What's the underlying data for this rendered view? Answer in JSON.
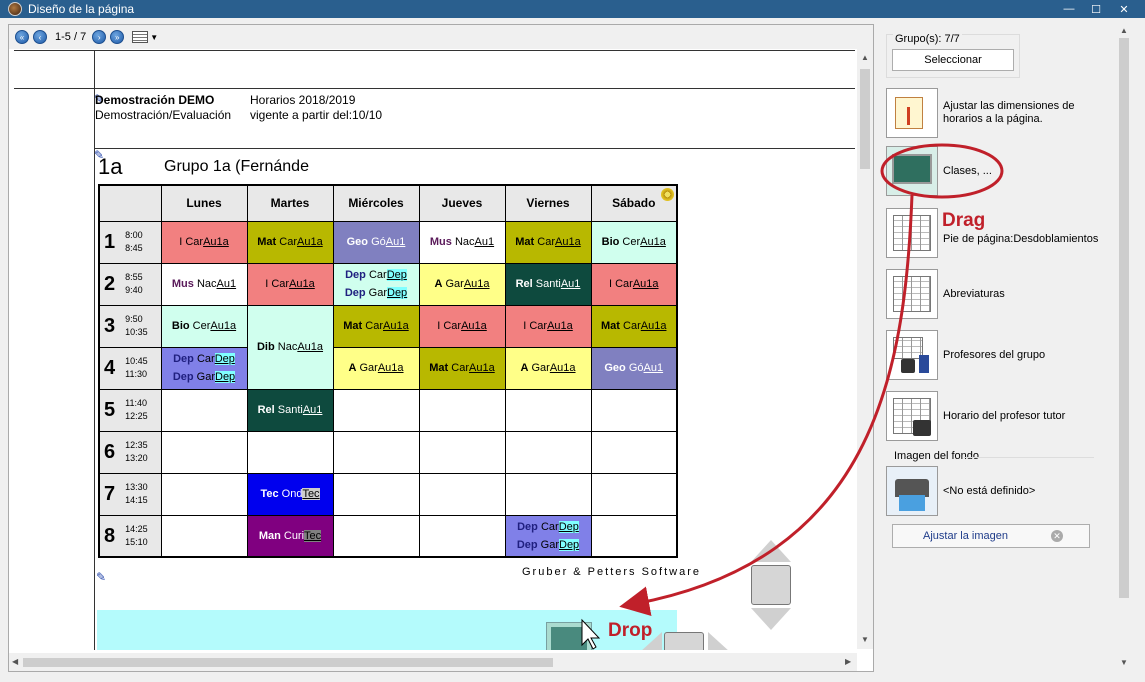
{
  "window": {
    "title": "Diseño de la página",
    "min": "—",
    "max": "☐",
    "close": "✕"
  },
  "nav": {
    "page_indicator": "1-5 / 7"
  },
  "header": {
    "school": "Demostración  DEMO",
    "schedule": "Horarios 2018/2019",
    "sub": "Demostración/Evaluación",
    "valid": "vigente a partir del:10/10"
  },
  "group": {
    "code": "1a",
    "title": "Grupo 1a (Fernánde"
  },
  "timetable": {
    "days": [
      "Lunes",
      "Martes",
      "Miércoles",
      "Jueves",
      "Viernes",
      "Sábado"
    ],
    "periods": [
      {
        "num": "1",
        "start": "8:00",
        "end": "8:45"
      },
      {
        "num": "2",
        "start": "8:55",
        "end": "9:40"
      },
      {
        "num": "3",
        "start": "9:50",
        "end": "10:35"
      },
      {
        "num": "4",
        "start": "10:45",
        "end": "11:30"
      },
      {
        "num": "5",
        "start": "11:40",
        "end": "12:25"
      },
      {
        "num": "6",
        "start": "12:35",
        "end": "13:20"
      },
      {
        "num": "7",
        "start": "13:30",
        "end": "14:15"
      },
      {
        "num": "8",
        "start": "14:25",
        "end": "15:10"
      }
    ],
    "rows": [
      [
        {
          "bg": "#f28080",
          "lines": [
            {
              "subject": "I",
              "teacher": "Car",
              "room": "Au1a",
              "bold": false
            }
          ]
        },
        {
          "bg": "#b8b800",
          "lines": [
            {
              "subject": "Mat",
              "teacher": "Car",
              "room": "Au1a"
            }
          ]
        },
        {
          "bg": "#8080c0",
          "color": "#ffffff",
          "lines": [
            {
              "subject": "Geo",
              "teacher": "Gó",
              "room": "Au1"
            }
          ]
        },
        {
          "bg": "#ffffff",
          "lines": [
            {
              "subject": "Mus",
              "teacher": "Nac",
              "room": "Au1",
              "subjcolor": "#5a1a5a"
            }
          ]
        },
        {
          "bg": "#b8b800",
          "lines": [
            {
              "subject": "Mat",
              "teacher": "Car",
              "room": "Au1a"
            }
          ]
        },
        {
          "bg": "#d0ffee",
          "lines": [
            {
              "subject": "Bio",
              "teacher": "Cer",
              "room": "Au1a"
            }
          ]
        }
      ],
      [
        {
          "bg": "#ffffff",
          "lines": [
            {
              "subject": "Mus",
              "teacher": "Nac",
              "room": "Au1",
              "subjcolor": "#5a1a5a"
            }
          ]
        },
        {
          "bg": "#f28080",
          "lines": [
            {
              "subject": "I",
              "teacher": "Car",
              "room": "Au1a",
              "bold": false
            }
          ]
        },
        {
          "bg": "#d0ffee",
          "lines": [
            {
              "subject": "Dep",
              "teacher": "Car",
              "room": "Dep",
              "roombg": "#80ffff",
              "subjcolor": "#202080"
            },
            {
              "subject": "Dep",
              "teacher": "Gar",
              "room": "Dep",
              "roombg": "#80ffff",
              "subjcolor": "#202080"
            }
          ]
        },
        {
          "bg": "#ffff88",
          "lines": [
            {
              "subject": "A",
              "teacher": "Gar",
              "room": "Au1a"
            }
          ]
        },
        {
          "bg": "#0e4a3e",
          "color": "#ffffff",
          "lines": [
            {
              "subject": "Rel",
              "teacher": "Santi",
              "room": "Au1"
            }
          ]
        },
        {
          "bg": "#f28080",
          "lines": [
            {
              "subject": "I",
              "teacher": "Car",
              "room": "Au1a",
              "bold": false
            }
          ]
        }
      ],
      [
        {
          "bg": "#d0ffee",
          "lines": [
            {
              "subject": "Bio",
              "teacher": "Cer",
              "room": "Au1a"
            }
          ]
        },
        {
          "bg": "#d0ffee",
          "rowspan": 2,
          "lines": [
            {
              "subject": "Dib",
              "teacher": "Nac",
              "room": "Au1a"
            }
          ]
        },
        {
          "bg": "#b8b800",
          "lines": [
            {
              "subject": "Mat",
              "teacher": "Car",
              "room": "Au1a"
            }
          ]
        },
        {
          "bg": "#f28080",
          "lines": [
            {
              "subject": "I",
              "teacher": "Car",
              "room": "Au1a",
              "bold": false
            }
          ]
        },
        {
          "bg": "#f28080",
          "lines": [
            {
              "subject": "I",
              "teacher": "Car",
              "room": "Au1a",
              "bold": false
            }
          ]
        },
        {
          "bg": "#b8b800",
          "lines": [
            {
              "subject": "Mat",
              "teacher": "Car",
              "room": "Au1a"
            }
          ]
        }
      ],
      [
        {
          "bg": "#8080e8",
          "lines": [
            {
              "subject": "Dep",
              "teacher": "Car",
              "room": "Dep",
              "roombg": "#80ffff",
              "subjcolor": "#202080"
            },
            {
              "subject": "Dep",
              "teacher": "Gar",
              "room": "Dep",
              "roombg": "#80ffff",
              "subjcolor": "#202080"
            }
          ]
        },
        null,
        {
          "bg": "#ffff88",
          "lines": [
            {
              "subject": "A",
              "teacher": "Gar",
              "room": "Au1a"
            }
          ]
        },
        {
          "bg": "#b8b800",
          "lines": [
            {
              "subject": "Mat",
              "teacher": "Car",
              "room": "Au1a"
            }
          ]
        },
        {
          "bg": "#ffff88",
          "lines": [
            {
              "subject": "A",
              "teacher": "Gar",
              "room": "Au1a"
            }
          ]
        },
        {
          "bg": "#8080c0",
          "color": "#ffffff",
          "lines": [
            {
              "subject": "Geo",
              "teacher": "Gó",
              "room": "Au1"
            }
          ]
        }
      ],
      [
        {
          "bg": "#ffffff",
          "lines": []
        },
        {
          "bg": "#0e4a3e",
          "color": "#ffffff",
          "lines": [
            {
              "subject": "Rel",
              "teacher": "Santi",
              "room": "Au1"
            }
          ]
        },
        {
          "bg": "#ffffff",
          "lines": []
        },
        {
          "bg": "#ffffff",
          "lines": []
        },
        {
          "bg": "#ffffff",
          "lines": []
        },
        {
          "bg": "#ffffff",
          "lines": []
        }
      ],
      [
        {
          "bg": "#ffffff",
          "lines": []
        },
        {
          "bg": "#ffffff",
          "lines": []
        },
        {
          "bg": "#ffffff",
          "lines": []
        },
        {
          "bg": "#ffffff",
          "lines": []
        },
        {
          "bg": "#ffffff",
          "lines": []
        },
        {
          "bg": "#ffffff",
          "lines": []
        }
      ],
      [
        {
          "bg": "#ffffff",
          "lines": []
        },
        {
          "bg": "#0000ee",
          "color": "#ffffff",
          "lines": [
            {
              "subject": "Tec",
              "teacher": "Ond",
              "room": "Tec",
              "roombg": "#cccccc",
              "roomcolor": "#000000"
            }
          ]
        },
        {
          "bg": "#ffffff",
          "lines": []
        },
        {
          "bg": "#ffffff",
          "lines": []
        },
        {
          "bg": "#ffffff",
          "lines": []
        },
        {
          "bg": "#ffffff",
          "lines": []
        }
      ],
      [
        {
          "bg": "#ffffff",
          "lines": []
        },
        {
          "bg": "#800080",
          "color": "#ffffff",
          "lines": [
            {
              "subject": "Man",
              "teacher": "Curi",
              "room": "Tec",
              "roombg": "#808080",
              "roomcolor": "#000000"
            }
          ]
        },
        {
          "bg": "#ffffff",
          "lines": []
        },
        {
          "bg": "#ffffff",
          "lines": []
        },
        {
          "bg": "#8080e8",
          "lines": [
            {
              "subject": "Dep",
              "teacher": "Car",
              "room": "Dep",
              "roombg": "#80ffff",
              "subjcolor": "#202080"
            },
            {
              "subject": "Dep",
              "teacher": "Gar",
              "room": "Dep",
              "roombg": "#80ffff",
              "subjcolor": "#202080"
            }
          ]
        },
        {
          "bg": "#ffffff",
          "lines": []
        }
      ]
    ]
  },
  "footer": {
    "vendor": "Gruber & Petters Software"
  },
  "panel": {
    "groups_label": "Grupo(s): 7/7",
    "select_button": "Seleccionar",
    "items": [
      {
        "label": "Ajustar las dimensiones de horarios a la página.",
        "icon": "resize-page-icon"
      },
      {
        "label": "Clases, ...",
        "icon": "chalkboard-icon"
      },
      {
        "label": "Pie de página:Desdoblamientos",
        "icon": "footer-layout-icon"
      },
      {
        "label": "Abreviaturas",
        "icon": "abbreviations-icon"
      },
      {
        "label": "Profesores del grupo",
        "icon": "teachers-icon"
      },
      {
        "label": "Horario del profesor tutor",
        "icon": "tutor-schedule-icon"
      }
    ],
    "background_label": "Imagen del fondo",
    "background_value": "<No está definido>",
    "adjust_image_button": "Ajustar la imagen"
  },
  "annotations": {
    "drag": "Drag",
    "drop": "Drop"
  }
}
